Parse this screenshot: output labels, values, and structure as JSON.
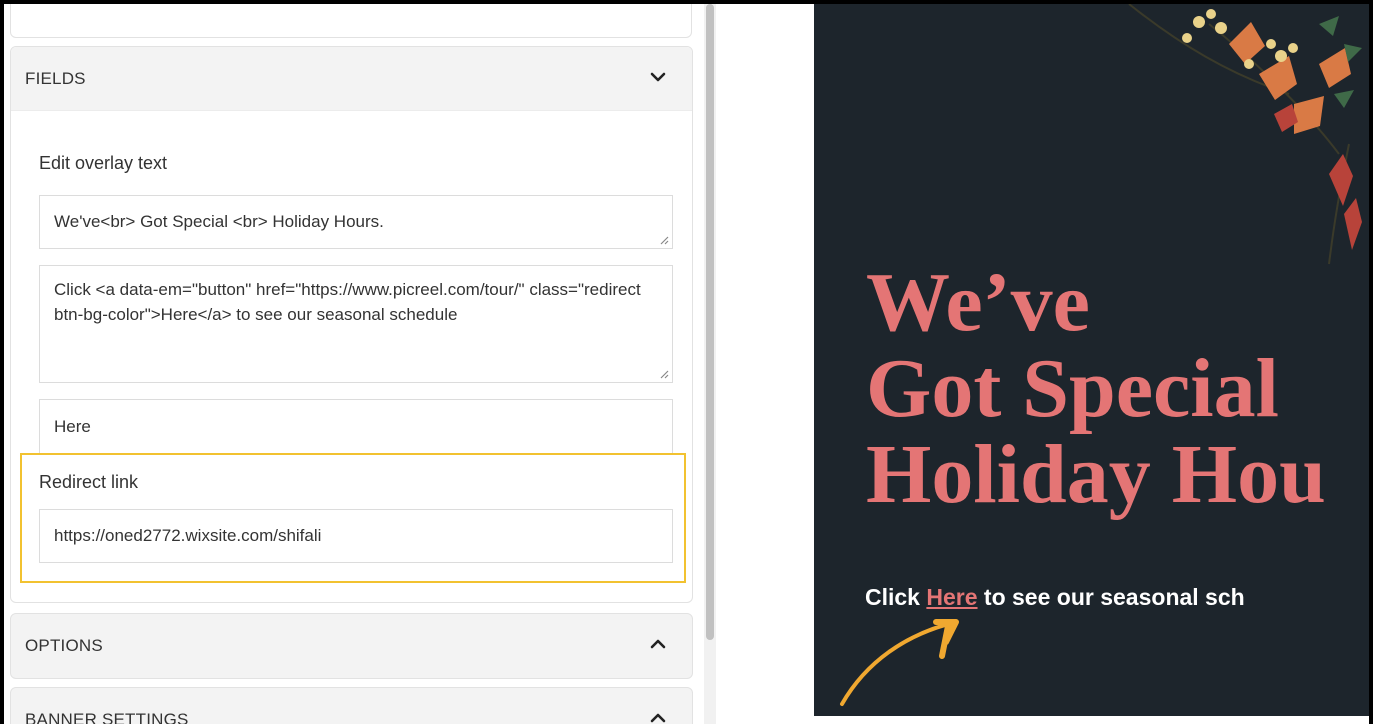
{
  "fields_section": {
    "title": "FIELDS",
    "edit_overlay_label": "Edit overlay text",
    "headline_input": "We've<br> Got Special <br> Holiday Hours.",
    "subtext_input": "Click <a data-em=\"button\" href=\"https://www.picreel.com/tour/\" class=\"redirect  btn-bg-color\">Here</a> to see our seasonal schedule",
    "button_text_input": "Here",
    "redirect_label": "Redirect link",
    "redirect_input": "https://oned2772.wixsite.com/shifali"
  },
  "options_section": {
    "title": "OPTIONS"
  },
  "banner_section": {
    "title": "BANNER SETTINGS"
  },
  "preview": {
    "headline_line1": "We’ve",
    "headline_line2": "Got Special",
    "headline_line3": "Holiday Hou",
    "sub_before": "Click ",
    "sub_link": "Here",
    "sub_after": " to see our seasonal sch",
    "background_color": "#1d252c",
    "headline_color": "#e47575",
    "arrow_color": "#f0a830"
  },
  "icons": {
    "fields_toggle": "chevron-down-icon",
    "options_toggle": "chevron-up-icon",
    "banner_toggle": "chevron-up-icon"
  }
}
